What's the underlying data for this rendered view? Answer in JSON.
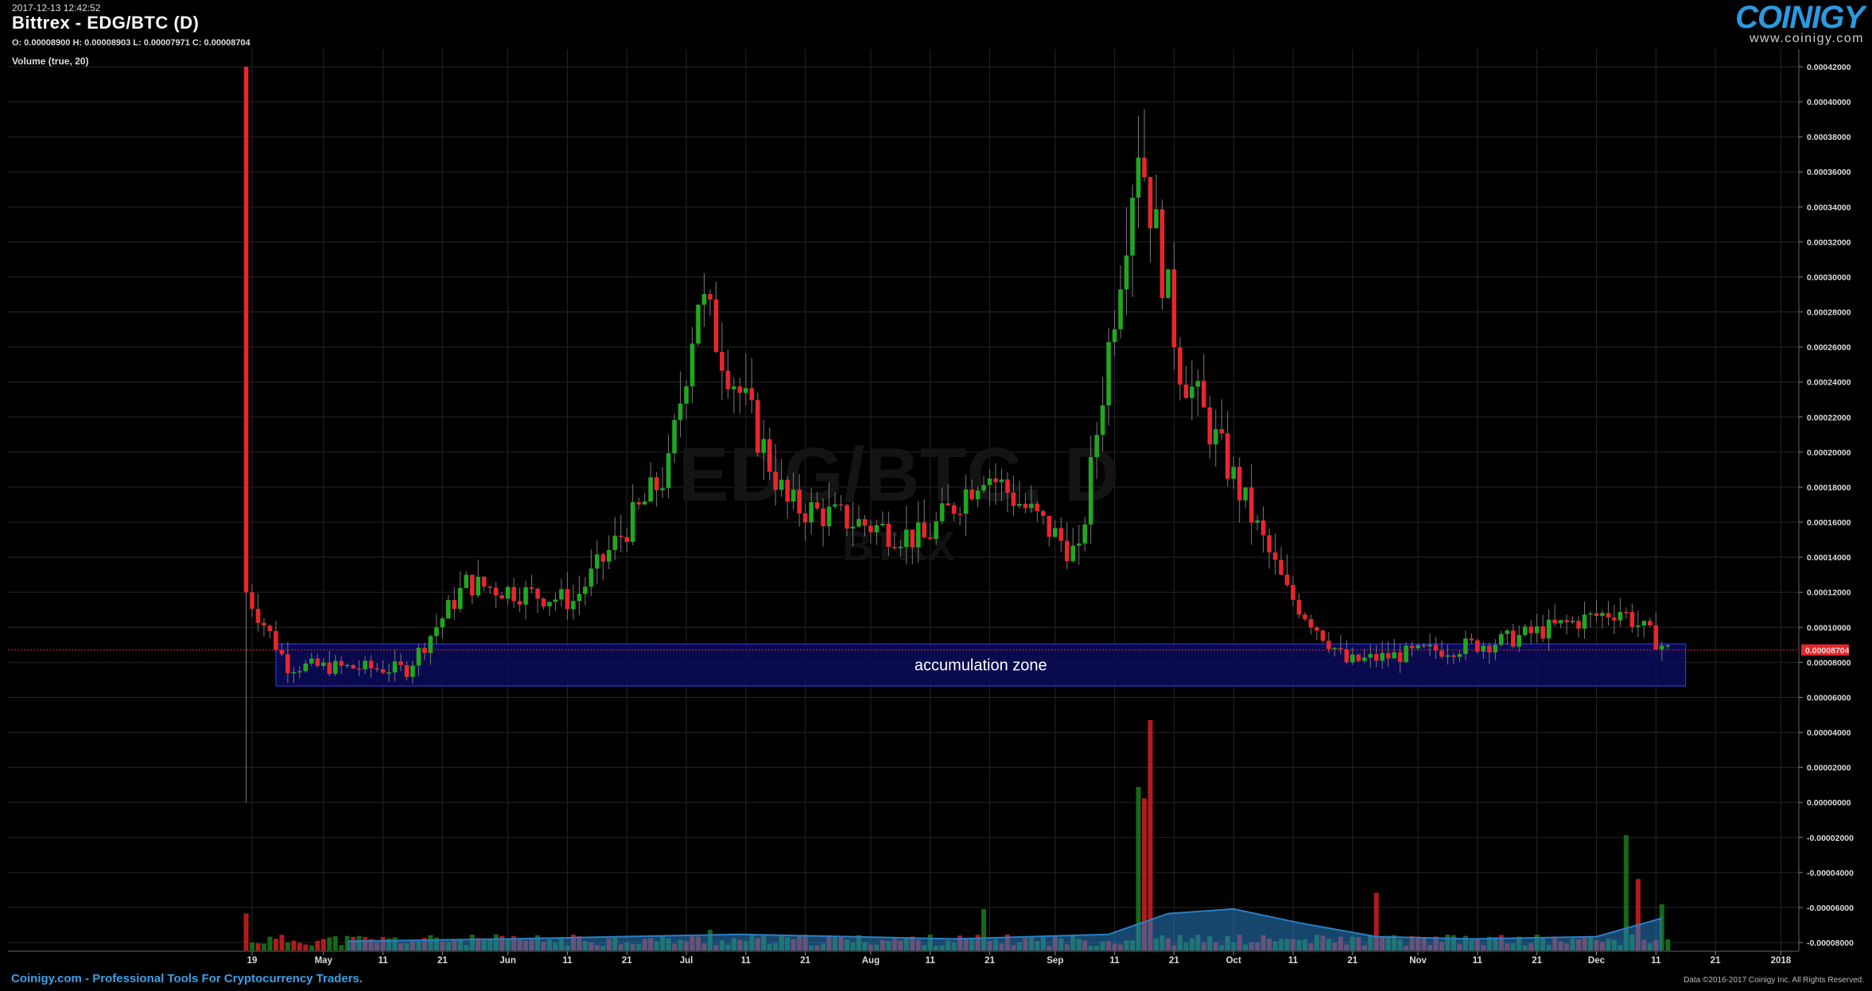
{
  "header": {
    "timestamp": "2017-12-13 12:42:52",
    "title": "Bittrex - EDG/BTC (D)",
    "ohlc": "O: 0.00008900 H: 0.00008903 L: 0.00007971 C: 0.00008704",
    "volume_label": "Volume (true, 20)"
  },
  "logo": {
    "word": "COINIGY",
    "url": "www.coinigy.com"
  },
  "footer": {
    "left": "Coinigy.com - Professional Tools For Cryptocurrency Traders.",
    "right": "Data ©2016-2017 Coinigy Inc. All Rights Reserved."
  },
  "watermark": {
    "line1": "EDG/BTC, D",
    "line2": "BTRX"
  },
  "colors": {
    "background": "#000000",
    "up": "#1fa81f",
    "down": "#e8262c",
    "grid": "#262626",
    "zone_fill": "#0a0a5c",
    "zone_border": "#3a3aff",
    "volume_ma": "#2a7fc7",
    "last_price_tag": "#e8262c"
  },
  "chart_data": {
    "type": "candlestick",
    "pair": "EDG/BTC",
    "exchange": "Bittrex",
    "timeframe": "D",
    "ylim": [
      -8e-05,
      0.00042
    ],
    "y_ticks": [
      "0.00042000",
      "0.00040000",
      "0.00038000",
      "0.00036000",
      "0.00034000",
      "0.00032000",
      "0.00030000",
      "0.00028000",
      "0.00026000",
      "0.00024000",
      "0.00022000",
      "0.00020000",
      "0.00018000",
      "0.00016000",
      "0.00014000",
      "0.00012000",
      "0.00010000",
      "0.00008000",
      "0.00006000",
      "0.00004000",
      "0.00002000",
      "0.00000000",
      "-0.00002000",
      "-0.00004000",
      "-0.00006000",
      "-0.00008000"
    ],
    "x_ticks": [
      "19",
      "May",
      "11",
      "21",
      "Jun",
      "11",
      "21",
      "Jul",
      "11",
      "21",
      "Aug",
      "11",
      "21",
      "Sep",
      "11",
      "21",
      "Oct",
      "11",
      "21",
      "Nov",
      "11",
      "21",
      "Dec",
      "11",
      "21",
      "2018"
    ],
    "last_price": "0.00008704",
    "annotation": {
      "label": "accumulation zone",
      "price_range": [
        6.65e-05,
        9.05e-05
      ],
      "date_range": [
        "2017-04-23",
        "2017-12-16"
      ]
    },
    "sampled_closes": [
      {
        "date": "2017-04-18",
        "close": 0.00012
      },
      {
        "date": "2017-04-25",
        "close": 7.8e-05
      },
      {
        "date": "2017-05-15",
        "close": 7.6e-05
      },
      {
        "date": "2017-05-25",
        "close": 0.000125
      },
      {
        "date": "2017-06-12",
        "close": 0.000115
      },
      {
        "date": "2017-06-28",
        "close": 0.00019
      },
      {
        "date": "2017-07-03",
        "close": 0.00029
      },
      {
        "date": "2017-07-18",
        "close": 0.00017
      },
      {
        "date": "2017-08-10",
        "close": 0.00015
      },
      {
        "date": "2017-08-20",
        "close": 0.00019
      },
      {
        "date": "2017-09-05",
        "close": 0.00014
      },
      {
        "date": "2017-09-15",
        "close": 0.00038
      },
      {
        "date": "2017-09-22",
        "close": 0.00025
      },
      {
        "date": "2017-10-10",
        "close": 0.00012
      },
      {
        "date": "2017-10-20",
        "close": 8e-05
      },
      {
        "date": "2017-11-15",
        "close": 9.2e-05
      },
      {
        "date": "2017-12-05",
        "close": 0.00011
      },
      {
        "date": "2017-12-13",
        "close": 8.7e-05
      }
    ],
    "volume": {
      "ylim": [
        0,
        1
      ],
      "sampled": [
        {
          "date": "2017-04-18",
          "value": 0.16,
          "dir": "down"
        },
        {
          "date": "2017-07-05",
          "value": 0.09,
          "dir": "up"
        },
        {
          "date": "2017-08-20",
          "value": 0.18,
          "dir": "up"
        },
        {
          "date": "2017-09-15",
          "value": 0.71,
          "dir": "up"
        },
        {
          "date": "2017-09-16",
          "value": 0.66,
          "dir": "down"
        },
        {
          "date": "2017-09-17",
          "value": 1.0,
          "dir": "down"
        },
        {
          "date": "2017-10-25",
          "value": 0.25,
          "dir": "down"
        },
        {
          "date": "2017-12-06",
          "value": 0.5,
          "dir": "up"
        },
        {
          "date": "2017-12-08",
          "value": 0.31,
          "dir": "down"
        },
        {
          "date": "2017-12-12",
          "value": 0.2,
          "dir": "up"
        }
      ]
    },
    "grid": true
  }
}
